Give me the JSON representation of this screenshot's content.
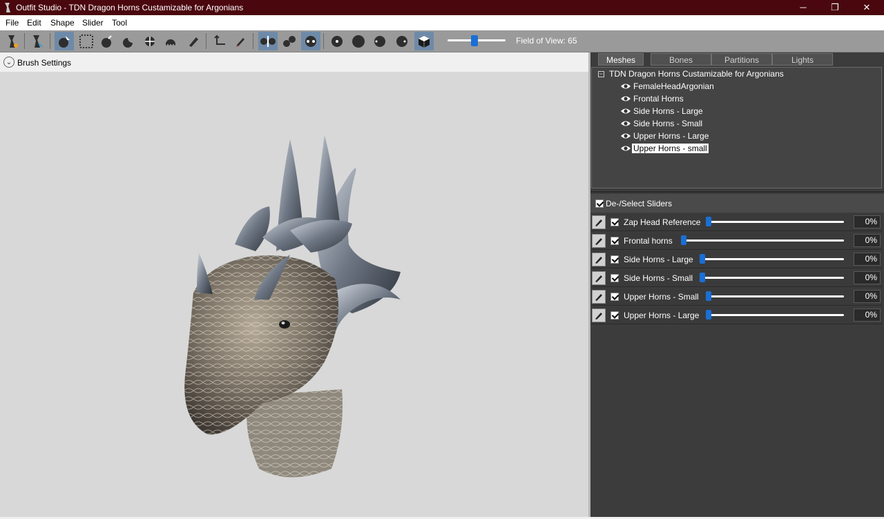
{
  "window": {
    "title": "Outfit Studio - TDN Dragon Horns Custamizable for Argonians",
    "minimize_glyph": "─",
    "maximize_glyph": "❐",
    "close_glyph": "✕"
  },
  "menu": [
    "File",
    "Edit",
    "Shape",
    "Slider",
    "Tool"
  ],
  "toolbar": {
    "icons": [
      "outfit-icon",
      "ref-icon",
      "select-icon",
      "mask-icon",
      "inflate-icon",
      "deflate-icon",
      "move-icon",
      "smooth-icon",
      "weight-paint-icon",
      "transform-icon",
      "pen-icon",
      "x-mirror-icon",
      "connected-icon",
      "both-sides-icon",
      "brush-size-1-icon",
      "brush-size-2-icon",
      "brush-size-3-icon",
      "brush-size-4-icon",
      "wireframe-icon"
    ],
    "fov_label": "Field of View: 65",
    "fov_value": 65
  },
  "brush_settings": {
    "label": "Brush Settings",
    "chevron": "⌄"
  },
  "tabs": [
    {
      "label": "Meshes",
      "active": true
    },
    {
      "label": "Bones",
      "active": false
    },
    {
      "label": "Partitions",
      "active": false
    },
    {
      "label": "Lights",
      "active": false
    }
  ],
  "mesh_tree": {
    "root": "TDN Dragon Horns Custamizable for Argonians",
    "toggle": "−",
    "items": [
      {
        "label": "FemaleHeadArgonian",
        "selected": false
      },
      {
        "label": "Frontal Horns",
        "selected": false
      },
      {
        "label": "Side Horns - Large",
        "selected": false
      },
      {
        "label": "Side Horns - Small",
        "selected": false
      },
      {
        "label": "Upper Horns - Large",
        "selected": false
      },
      {
        "label": "Upper Horns - small",
        "selected": true
      }
    ]
  },
  "sliders_header": {
    "label": "De-/Select Sliders",
    "checked": true
  },
  "sliders": [
    {
      "label": "Zap Head Reference",
      "value": "0%",
      "checked": true
    },
    {
      "label": "Frontal horns",
      "value": "0%",
      "checked": true
    },
    {
      "label": "Side Horns - Large",
      "value": "0%",
      "checked": true
    },
    {
      "label": "Side Horns - Small",
      "value": "0%",
      "checked": true
    },
    {
      "label": "Upper Horns - Small",
      "value": "0%",
      "checked": true
    },
    {
      "label": "Upper Horns - Large",
      "value": "0%",
      "checked": true
    }
  ],
  "colors": {
    "titlebar": "#4a070e",
    "accent": "#1a6fd6",
    "panel": "#3c3c3c",
    "viewport": "#d8d8d8"
  }
}
